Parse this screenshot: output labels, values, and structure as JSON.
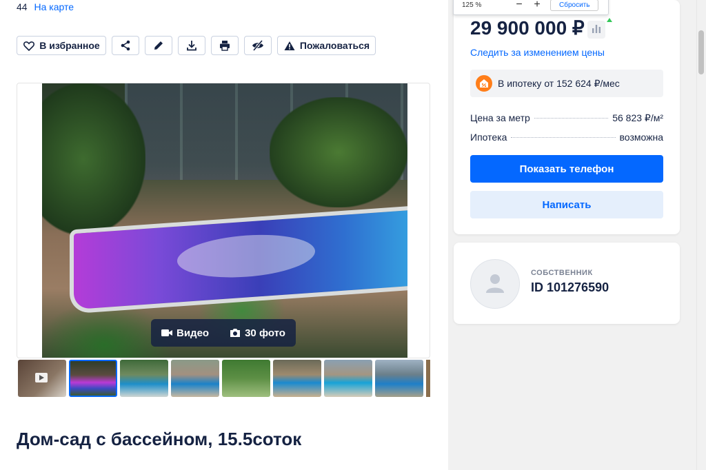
{
  "address": {
    "text": "44",
    "map_link": "На карте"
  },
  "actions": {
    "favorite": "В избранное",
    "report": "Пожаловаться"
  },
  "icons": {
    "favorite": "heart-icon",
    "share": "share-icon",
    "edit": "pencil-icon",
    "download": "download-icon",
    "print": "print-icon",
    "hide": "hide-icon",
    "report": "warning-icon"
  },
  "gallery": {
    "video_label": "Видео",
    "photos_label": "30 фото",
    "thumbnail_count": 8
  },
  "title": "Дом-сад с бассейном, 15.5соток",
  "zoom_bar": {
    "level": "125 %",
    "minus": "−",
    "plus": "+",
    "reset": "Сбросить"
  },
  "price_card": {
    "price": "29 900 000 ₽",
    "follow_label": "Следить за изменением цены",
    "mortgage": "В ипотеку от 152 624 ₽/мес",
    "price_per_meter_label": "Цена за метр",
    "price_per_meter_value": "56 823 ₽/м²",
    "mortgage_label": "Ипотека",
    "mortgage_value": "возможна",
    "show_phone": "Показать телефон",
    "write": "Написать"
  },
  "owner_card": {
    "role": "СОБСТВЕННИК",
    "id": "ID 101276590"
  },
  "colors": {
    "accent": "#0468ff",
    "accent_light": "#e5effc",
    "text": "#152242",
    "mortgage_icon": "#ff7e1a"
  }
}
